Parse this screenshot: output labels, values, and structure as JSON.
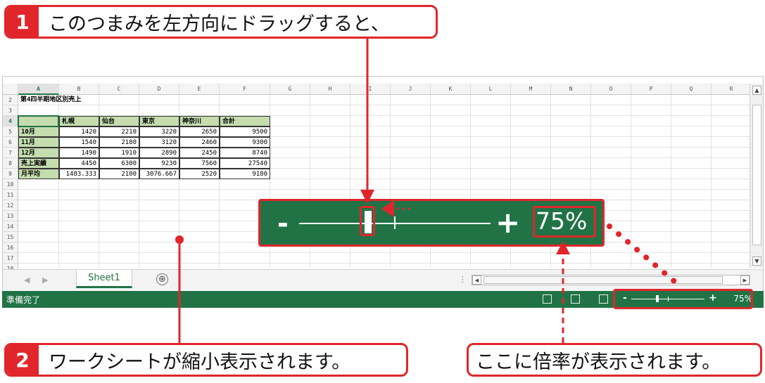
{
  "callouts": {
    "c1": {
      "num": "1",
      "text": "このつまみを左方向にドラッグすると、"
    },
    "c2": {
      "num": "2",
      "text": "ワークシートが縮小表示されます。"
    },
    "c3": {
      "text": "ここに倍率が表示されます。"
    }
  },
  "sheet": {
    "columns": [
      "A",
      "B",
      "C",
      "D",
      "E",
      "F",
      "G",
      "H",
      "I",
      "J",
      "K",
      "L",
      "M",
      "N",
      "O",
      "P",
      "Q",
      "R"
    ],
    "rows": [
      "2",
      "3",
      "4",
      "5",
      "6",
      "7",
      "8",
      "9",
      "10",
      "11",
      "12",
      "13",
      "14",
      "15",
      "16",
      "17",
      "18"
    ],
    "title": "第4四半期地区別売上",
    "headers": [
      "",
      "札幌",
      "仙台",
      "東京",
      "神奈川",
      "合計"
    ],
    "data": [
      [
        "10月",
        "1420",
        "2210",
        "3220",
        "2650",
        "9500"
      ],
      [
        "11月",
        "1540",
        "2180",
        "3120",
        "2460",
        "9300"
      ],
      [
        "12月",
        "1490",
        "1910",
        "2890",
        "2450",
        "8740"
      ],
      [
        "売上実績",
        "4450",
        "6300",
        "9230",
        "7560",
        "27540"
      ],
      [
        "月平均",
        "1483.333",
        "2100",
        "3076.667",
        "2520",
        "9180"
      ]
    ],
    "tab": "Sheet1",
    "add_sheet": "⊕"
  },
  "status": {
    "ready": "準備完了",
    "zoom_percent": "75%",
    "zoom_minus": "-",
    "zoom_plus": "+"
  },
  "zoom_panel": {
    "minus": "-",
    "plus": "+",
    "percent": "75%"
  },
  "colors": {
    "excel_green": "#217346",
    "accent_red": "#e0262b",
    "header_fill": "#c4dcae"
  }
}
